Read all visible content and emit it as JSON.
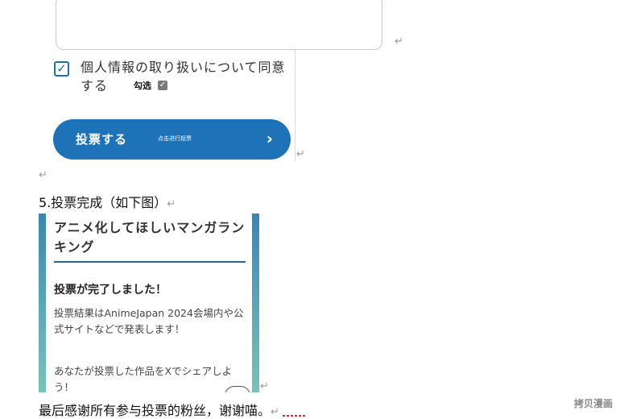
{
  "return_mark": "↵",
  "consent": {
    "text": "個人情報の取り扱いについて同意する",
    "tag": "勾选",
    "check_glyph": "✓"
  },
  "vote_button": {
    "label": "投票する",
    "note": "点击进行投票",
    "chevron": "›"
  },
  "step": "5.投票完成（如下图）",
  "complete_page": {
    "heading": "アニメ化してほしいマンガランキング",
    "title": "投票が完了しました！",
    "result": "投票結果はAnimeJapan 2024会場内や公式サイトなどで発表します！",
    "share": "あなたが投票した作品をXでシェアしよう！"
  },
  "closing": "最后感谢所有参与投票的粉丝，谢谢喵。",
  "watermark": "拷贝漫画",
  "colors": {
    "accent": "#1e73b8",
    "checkbox": "#1f6fa8",
    "heading_rule": "#1e6a96"
  }
}
